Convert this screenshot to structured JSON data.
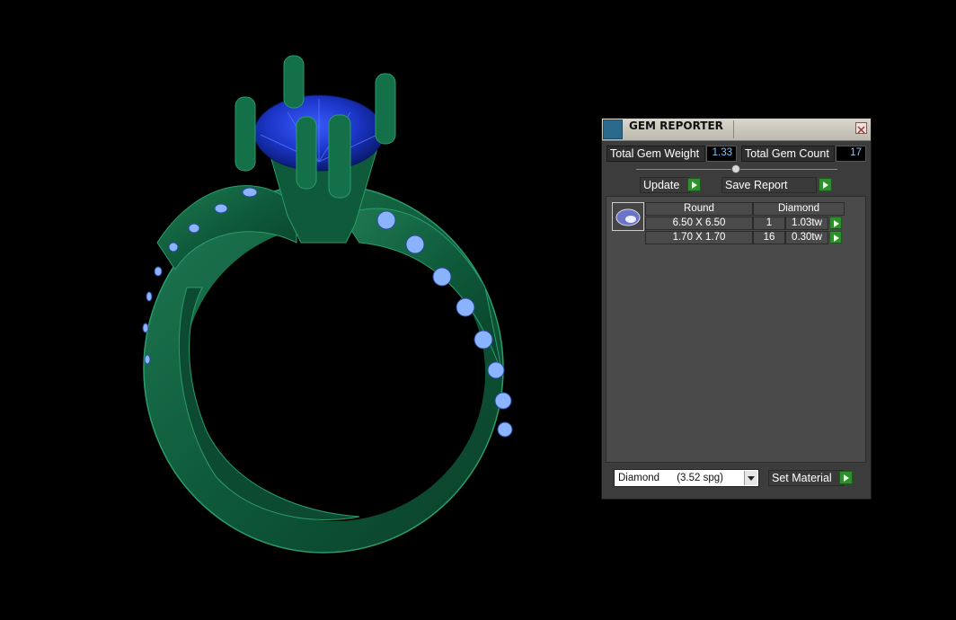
{
  "panel": {
    "title": "GEM REPORTER",
    "total_weight_label": "Total Gem Weight",
    "total_weight_value": "1.33",
    "total_count_label": "Total Gem Count",
    "total_count_value": "17",
    "update_label": "Update",
    "save_report_label": "Save Report",
    "table": {
      "shape_header": "Round",
      "material_header": "Diamond",
      "rows": [
        {
          "size": "6.50 X 6.50",
          "count": "1",
          "weight": "1.03tw"
        },
        {
          "size": "1.70 X 1.70",
          "count": "16",
          "weight": "0.30tw"
        }
      ]
    },
    "material_select": "Diamond      (3.52 spg)",
    "set_material_label": "Set Material"
  },
  "colors": {
    "metal": "#0f5a3a",
    "center_stone": "#1830b8",
    "side_stones": "#8ab4ff",
    "accent_go": "#2e8f2e"
  },
  "icons": [
    "gem-reporter-app-icon",
    "close-icon",
    "slider-knob",
    "go-arrow-icon",
    "gem-thumbnail-icon",
    "dropdown-arrow-icon"
  ]
}
